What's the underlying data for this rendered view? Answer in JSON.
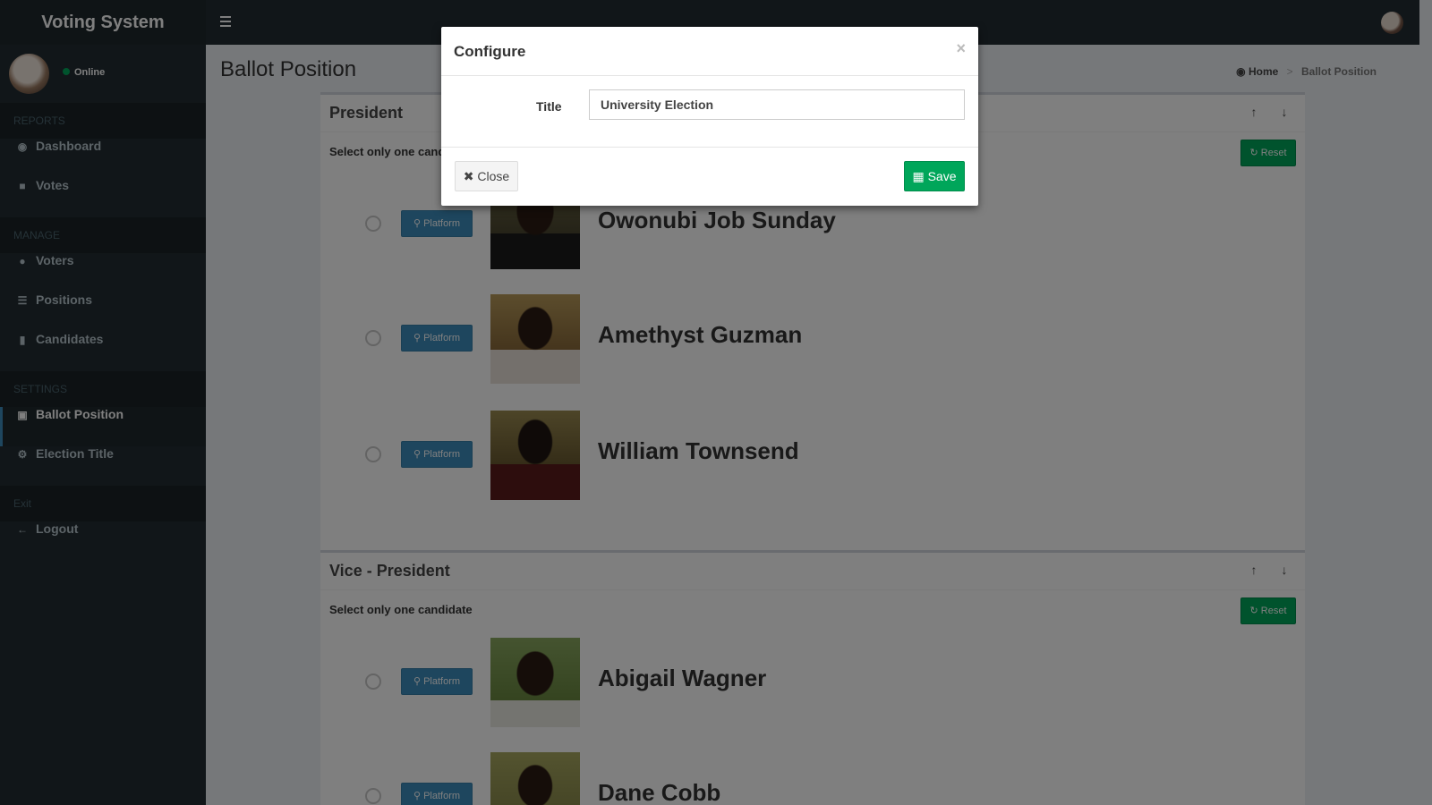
{
  "app": {
    "title": "Voting System"
  },
  "user": {
    "status": "Online"
  },
  "sidebar": {
    "sections": [
      {
        "header": "REPORTS",
        "items": [
          {
            "label": "Dashboard",
            "icon": "dashboard-icon"
          },
          {
            "label": "Votes",
            "icon": "lock-icon"
          }
        ]
      },
      {
        "header": "MANAGE",
        "items": [
          {
            "label": "Voters",
            "icon": "users-icon"
          },
          {
            "label": "Positions",
            "icon": "list-icon"
          },
          {
            "label": "Candidates",
            "icon": "id-card-icon"
          }
        ]
      },
      {
        "header": "SETTINGS",
        "items": [
          {
            "label": "Ballot Position",
            "icon": "file-icon",
            "active": true
          },
          {
            "label": "Election Title",
            "icon": "gear-icon"
          }
        ]
      },
      {
        "header": "Exit",
        "items": [
          {
            "label": "Logout",
            "icon": "arrow-left-icon"
          }
        ]
      }
    ]
  },
  "page": {
    "title": "Ballot Position",
    "breadcrumb": {
      "home": "Home",
      "current": "Ballot Position"
    }
  },
  "positions": [
    {
      "title": "President",
      "instruction": "Select only one candidate",
      "reset_label": "Reset",
      "candidates": [
        {
          "name": "Owonubi Job Sunday",
          "platform_label": "Platform"
        },
        {
          "name": "Amethyst Guzman",
          "platform_label": "Platform"
        },
        {
          "name": "William Townsend",
          "platform_label": "Platform"
        }
      ]
    },
    {
      "title": "Vice - President",
      "instruction": "Select only one candidate",
      "reset_label": "Reset",
      "candidates": [
        {
          "name": "Abigail Wagner",
          "platform_label": "Platform"
        },
        {
          "name": "Dane Cobb",
          "platform_label": "Platform"
        }
      ]
    }
  ],
  "modal": {
    "title": "Configure",
    "close_symbol": "×",
    "field_label": "Title",
    "field_value": "University Election",
    "close_label": "Close",
    "save_label": "Save"
  },
  "colors": {
    "sidebar": "#222d32",
    "primary": "#3c8dbc",
    "success": "#00a65a"
  }
}
